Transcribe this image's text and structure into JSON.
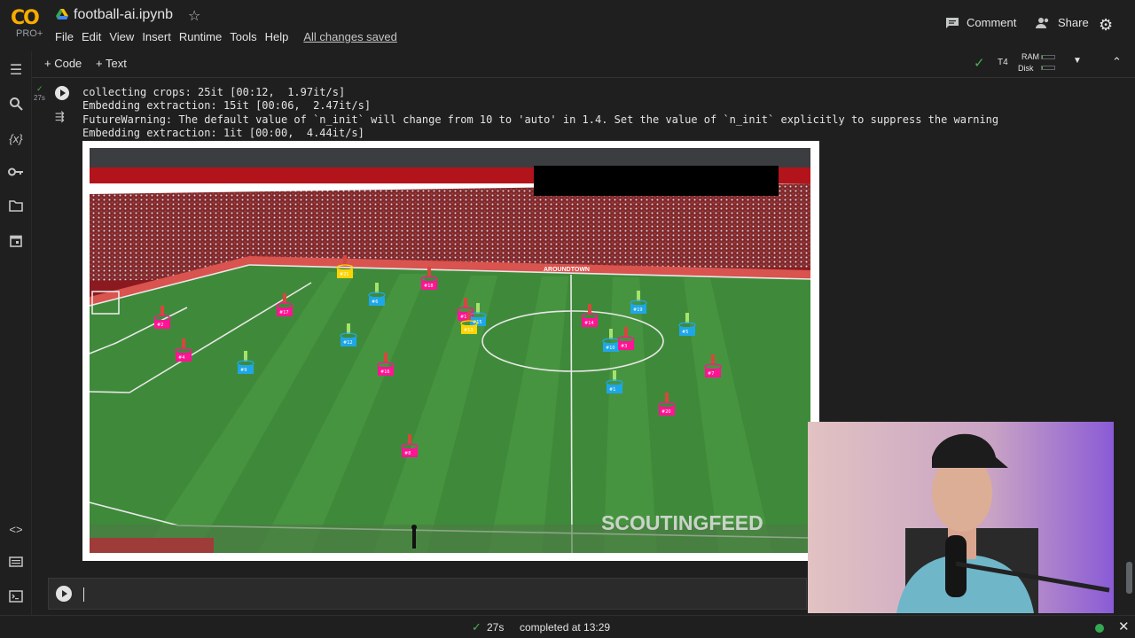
{
  "app": {
    "logo_text": "CO",
    "logo_sub": "PRO+",
    "notebook_title": "football-ai.ipynb"
  },
  "menu": {
    "items": [
      "File",
      "Edit",
      "View",
      "Insert",
      "Runtime",
      "Tools",
      "Help"
    ],
    "saved_status": "All changes saved"
  },
  "header_actions": {
    "comment_label": "Comment",
    "share_label": "Share"
  },
  "toolbar": {
    "add_code_label": "+ Code",
    "add_text_label": "+ Text",
    "runtime_type": "T4",
    "ram_label": "RAM",
    "disk_label": "Disk",
    "ram_usage_fraction": 0.1,
    "disk_usage_fraction": 0.1
  },
  "cell": {
    "exec_time": "27s",
    "output_lines": [
      "collecting crops: 25it [00:12,  1.97it/s]",
      "Embedding extraction: 15it [00:06,  2.47it/s]",
      "FutureWarning: The default value of `n_init` will change from 10 to 'auto' in 1.4. Set the value of `n_init` explicitly to suppress the warning",
      "Embedding extraction: 1it [00:00,  4.44it/s]"
    ],
    "video": {
      "watermark": "SCOUTINGFEED",
      "ad_board_text": "AROUNDTOWN",
      "team_colors": {
        "team_a": "#ff1493",
        "team_b": "#1ea7e8",
        "referee": "#ffd400"
      },
      "player_tags": [
        {
          "label": "#21",
          "team": "referee"
        },
        {
          "label": "#18",
          "team": "team_a"
        },
        {
          "label": "#6",
          "team": "team_b"
        },
        {
          "label": "#17",
          "team": "team_a"
        },
        {
          "label": "#2",
          "team": "team_a"
        },
        {
          "label": "#4",
          "team": "team_a"
        },
        {
          "label": "#9",
          "team": "team_b"
        },
        {
          "label": "#12",
          "team": "team_b"
        },
        {
          "label": "#16",
          "team": "team_a"
        },
        {
          "label": "#11",
          "team": "team_a"
        },
        {
          "label": "#15",
          "team": "team_b"
        },
        {
          "label": "#13",
          "team": "referee"
        },
        {
          "label": "#14",
          "team": "team_a"
        },
        {
          "label": "#19",
          "team": "team_b"
        },
        {
          "label": "#5",
          "team": "team_b"
        },
        {
          "label": "#10",
          "team": "team_b"
        },
        {
          "label": "#3",
          "team": "team_a"
        },
        {
          "label": "#7",
          "team": "team_a"
        },
        {
          "label": "#1",
          "team": "team_b"
        },
        {
          "label": "#20",
          "team": "team_a"
        },
        {
          "label": "#8",
          "team": "team_a"
        }
      ]
    }
  },
  "statusbar": {
    "time": "27s",
    "completed_text": "completed at 13:29"
  },
  "icons": {
    "sidebar": [
      "toc-icon",
      "search-icon",
      "variables-icon",
      "secrets-icon",
      "files-icon",
      "calendar-icon",
      "code-snippets-icon",
      "command-palette-icon",
      "terminal-icon"
    ]
  }
}
